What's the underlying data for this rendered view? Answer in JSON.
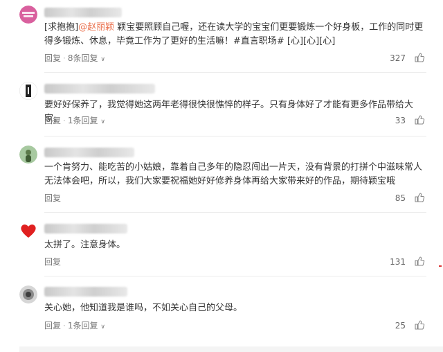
{
  "comments": [
    {
      "text_prefix": "[求抱抱]",
      "mention": "@赵丽颖",
      "text_body": " 颖宝要照顾自己喔，还在读大学的宝宝们更要锻炼一个好身板，工作的同时更得多锻炼、休息，毕竟工作为了更好的生活嘛！#直言职场# [心][心][心]",
      "reply_label": "回复",
      "sub_replies": "8条回复",
      "likes": "327"
    },
    {
      "text": "要好好保养了，我觉得她这两年老得很快很憔悴的样子。只有身体好了才能有更多作品带给大家。",
      "reply_label": "回复",
      "sub_replies": "1条回复",
      "likes": "33"
    },
    {
      "text": "一个肯努力、能吃苦的小姑娘，靠着自己多年的隐忍闯出一片天，没有背景的打拼个中滋味常人无法体会吧，所以，我们大家要祝福她好好修养身体再给大家带来好的作品，期待颖宝哦",
      "reply_label": "回复",
      "likes": "85"
    },
    {
      "text": "太拼了。注意身体。",
      "reply_label": "回复",
      "likes": "131"
    },
    {
      "text": "关心她，他知道我是谁吗，不如关心自己的父母。",
      "reply_label": "回复",
      "sub_replies": "1条回复",
      "likes": "25"
    }
  ],
  "colors": {
    "link": "#eb7350",
    "text": "#333333",
    "meta": "#777777"
  },
  "icons": {
    "like": "thumbs-up-icon",
    "expand": "chevron-down-icon"
  }
}
